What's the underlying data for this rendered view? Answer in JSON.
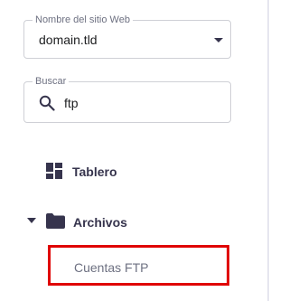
{
  "site_selector": {
    "label": "Nombre del sitio Web",
    "value": "domain.tld",
    "dropdown_icon": "caret-down-icon"
  },
  "search": {
    "label": "Buscar",
    "value": "ftp",
    "icon": "search-icon"
  },
  "nav": {
    "dashboard": {
      "label": "Tablero",
      "icon": "dashboard-grid-icon"
    },
    "files": {
      "label": "Archivos",
      "icon": "folder-icon",
      "expanded": true,
      "children": [
        {
          "label": "Cuentas FTP",
          "highlighted": true
        }
      ]
    }
  },
  "colors": {
    "text_dark": "#1d1e20",
    "nav_text": "#36344d",
    "muted": "#6d7081",
    "highlight_border": "#e00000"
  }
}
